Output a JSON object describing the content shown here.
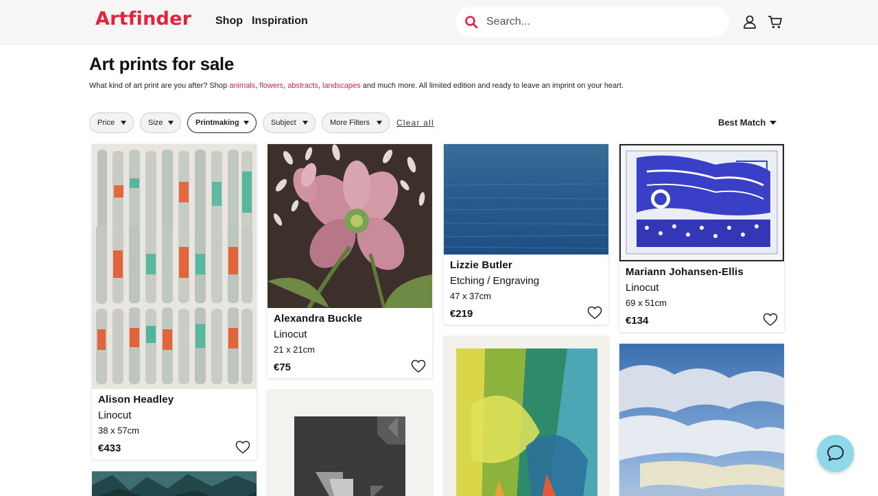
{
  "header": {
    "logo": "Artfinder",
    "nav": [
      "Shop",
      "Inspiration"
    ],
    "search_placeholder": "Search..."
  },
  "page": {
    "title": "Art prints for sale",
    "intro_prefix": "What kind of art print are you after? Shop ",
    "intro_links": [
      "animals",
      "flowers",
      "abstracts",
      "landscapes"
    ],
    "intro_suffix": " and much more. All limited edition and ready to leave an imprint on your heart."
  },
  "filters": {
    "items": [
      "Price",
      "Size",
      "Printmaking",
      "Subject",
      "More Filters"
    ],
    "active": "Printmaking",
    "clear_label": "Clear all",
    "sort_label": "Best Match"
  },
  "products": [
    {
      "artist": "Alison Headley",
      "medium": "Linocut",
      "size": "38 x 57cm",
      "price": "€433"
    },
    {
      "artist": "Alexandra Buckle",
      "medium": "Linocut",
      "size": "21 x 21cm",
      "price": "€75"
    },
    {
      "artist": "Lizzie Butler",
      "medium": "Etching / Engraving",
      "size": "47 x 37cm",
      "price": "€219"
    },
    {
      "artist": "Mariann Johansen-Ellis",
      "medium": "Linocut",
      "size": "69 x 51cm",
      "price": "€134"
    }
  ],
  "colors": {
    "brand": "#e3223c",
    "link": "#d8263f",
    "help_button": "#8fd8ea"
  }
}
